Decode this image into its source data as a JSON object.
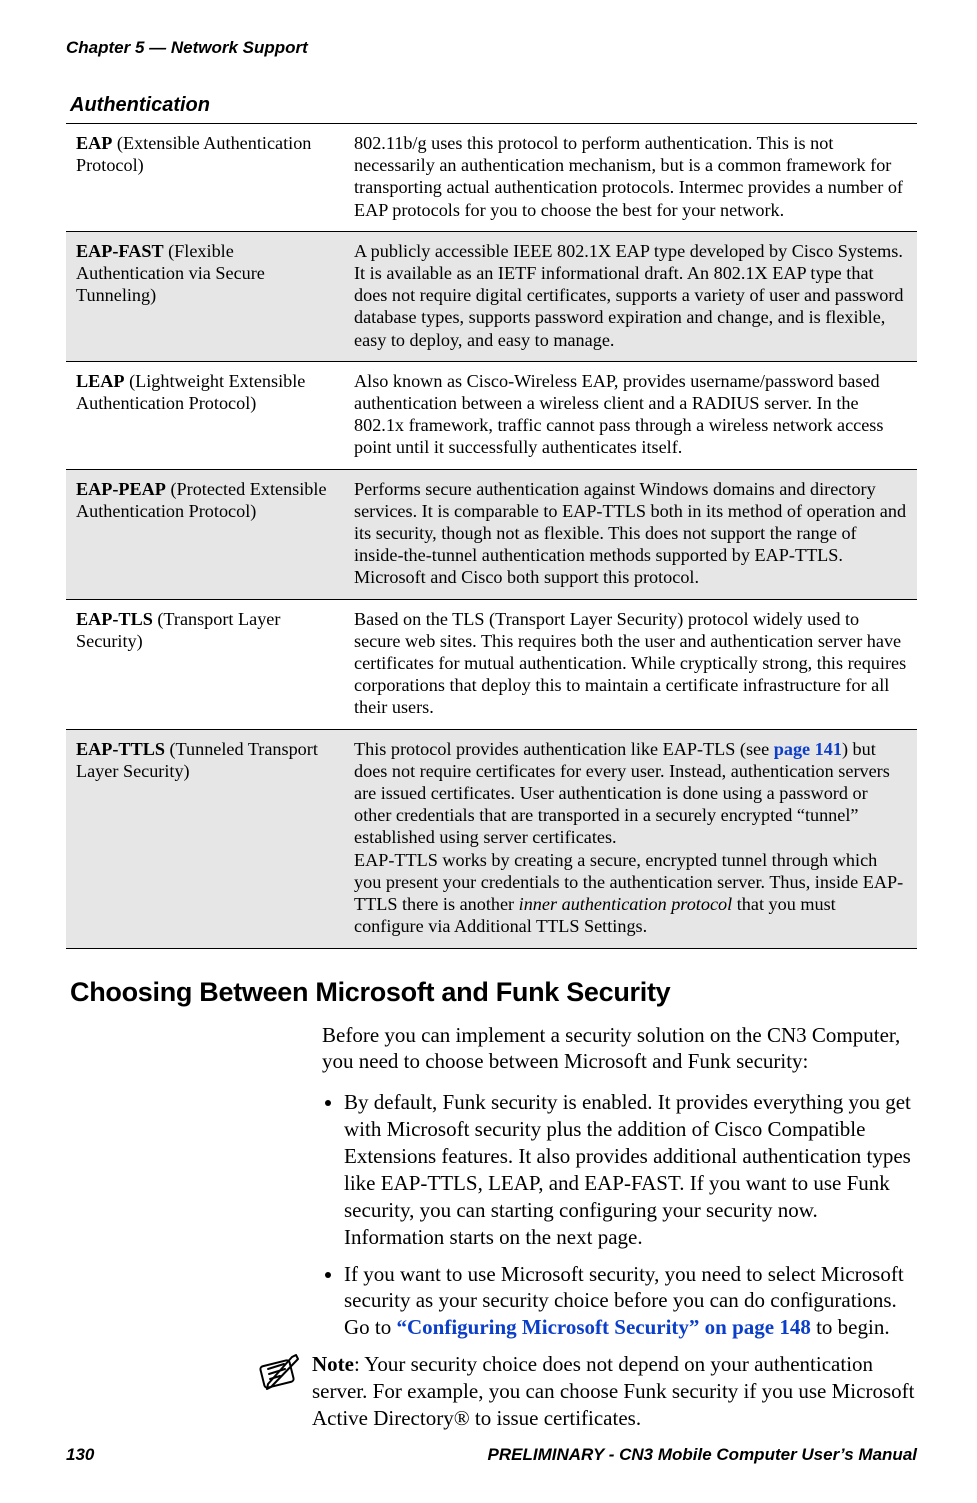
{
  "running_head": "Chapter 5 — Network Support",
  "section_heading": "Authentication",
  "table": [
    {
      "term_bold": "EAP",
      "term_rest": " (Extensible Authentication Protocol)",
      "desc": "802.11b/g uses this protocol to perform authentication. This is not necessarily an authentication mechanism, but is a common framework for transporting actual authentication protocols. Intermec provides a number of EAP protocols for you to choose the best for your network."
    },
    {
      "term_bold": "EAP-FAST",
      "term_rest": " (Flexible Authentication via Secure Tunneling)",
      "desc": "A publicly accessible IEEE 802.1X EAP type developed by Cisco Systems. It is available as an IETF informational draft. An 802.1X EAP type that does not require digital certificates, supports a variety of user and password database types, supports password expiration and change, and is flexible, easy to deploy, and easy to manage."
    },
    {
      "term_bold": "LEAP",
      "term_rest": " (Lightweight Extensible Authentication Protocol)",
      "desc": "Also known as Cisco-Wireless EAP, provides username/password based authentication between a wireless client and a RADIUS server. In the 802.1x framework, traffic cannot pass through a wireless network access point until it successfully authenticates itself."
    },
    {
      "term_bold": "EAP-PEAP",
      "term_rest": " (Protected Extensible Authentication Protocol)",
      "desc": "Performs secure authentication against Windows domains and directory services. It is comparable to EAP-TTLS both in its method of operation and its security, though not as flexible. This does not support the range of inside-the-tunnel authentication methods supported by EAP-TTLS. Microsoft and Cisco both support this protocol."
    },
    {
      "term_bold": "EAP-TLS",
      "term_rest": " (Transport Layer Security)",
      "desc": "Based on the TLS (Transport Layer Security) protocol widely used to secure web sites. This requires both the user and authentication server have certificates for mutual authentication. While cryptically strong, this requires corporations that deploy this to maintain a certificate infrastructure for all their users."
    },
    {
      "term_bold": "EAP-TTLS",
      "term_rest": " (Tunneled Transport Layer Security)",
      "desc_pre": "This protocol provides authentication like EAP-TLS (see ",
      "desc_link": "page 141",
      "desc_post": ") but does not require certificates for every user. Instead, authentication servers are issued certificates. User authentication is done using a password or other credentials that are transported in a securely encrypted “tunnel” established using server certificates.",
      "desc_para2_pre": "EAP-TTLS works by creating a secure, encrypted tunnel through which you present your credentials to the authentication server. Thus, inside EAP-TTLS there is another ",
      "desc_para2_ital": "inner authentication protocol",
      "desc_para2_post": " that you must configure via Additional TTLS Settings."
    }
  ],
  "h2": "Choosing Between Microsoft and Funk Security",
  "intro": "Before you can implement a security solution on the CN3 Computer, you need to choose between Microsoft and Funk security:",
  "bullets": [
    {
      "text": "By default, Funk security is enabled. It provides everything you get with Microsoft security plus the addition of Cisco Compatible Extensions features. It also provides additional authentication types like EAP-TTLS, LEAP, and EAP-FAST. If you want to use Funk security, you can starting configuring your security now. Information starts on the next page."
    },
    {
      "text_pre": "If you want to use Microsoft security, you need to select Microsoft security as your security choice before you can do configurations. Go to ",
      "link": "“Configuring Microsoft Security” on page 148",
      "text_post": " to begin."
    }
  ],
  "note_bold": "Note",
  "note_text": ": Your security choice does not depend on your authentication server. For example, you can choose Funk security if you use Microsoft Active Directory® to issue certificates.",
  "footer_left": "130",
  "footer_right": "PRELIMINARY - CN3 Mobile Computer User’s Manual"
}
